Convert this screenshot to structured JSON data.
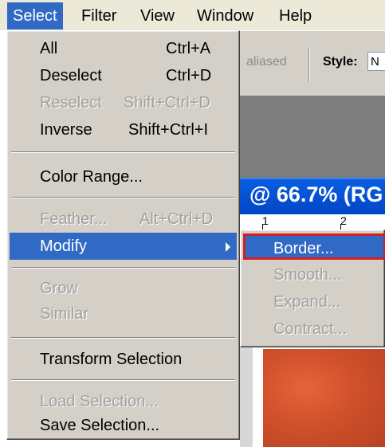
{
  "menubar": {
    "items": [
      {
        "label": "Select",
        "active": true
      },
      {
        "label": "Filter"
      },
      {
        "label": "View"
      },
      {
        "label": "Window"
      },
      {
        "label": "Help"
      }
    ]
  },
  "options_bar": {
    "aliased_label": "aliased",
    "style_label": "Style:",
    "style_value": "N"
  },
  "document": {
    "title": "@ 66.7% (RG",
    "ruler_labels": [
      "1",
      "2"
    ]
  },
  "select_menu": {
    "items": [
      {
        "label": "All",
        "shortcut": "Ctrl+A",
        "enabled": true
      },
      {
        "label": "Deselect",
        "shortcut": "Ctrl+D",
        "enabled": true
      },
      {
        "label": "Reselect",
        "shortcut": "Shift+Ctrl+D",
        "enabled": false
      },
      {
        "label": "Inverse",
        "shortcut": "Shift+Ctrl+I",
        "enabled": true
      },
      {
        "label": "Color Range...",
        "shortcut": "",
        "enabled": true
      },
      {
        "label": "Feather...",
        "shortcut": "Alt+Ctrl+D",
        "enabled": false
      },
      {
        "label": "Modify",
        "shortcut": "",
        "enabled": true,
        "highlighted": true,
        "submenu": true
      },
      {
        "label": "Grow",
        "shortcut": "",
        "enabled": false
      },
      {
        "label": "Similar",
        "shortcut": "",
        "enabled": false
      },
      {
        "label": "Transform Selection",
        "shortcut": "",
        "enabled": true
      },
      {
        "label": "Load Selection...",
        "shortcut": "",
        "enabled": false
      },
      {
        "label": "Save Selection...",
        "shortcut": "",
        "enabled": true
      }
    ]
  },
  "modify_menu": {
    "items": [
      {
        "label": "Border...",
        "enabled": true,
        "highlighted": true
      },
      {
        "label": "Smooth...",
        "enabled": false
      },
      {
        "label": "Expand...",
        "enabled": false
      },
      {
        "label": "Contract...",
        "enabled": false
      }
    ]
  },
  "colors": {
    "menu_bg": "#d4d0c8",
    "highlight": "#316ac5",
    "callout": "#d42020",
    "title_bar": "#0246c8"
  }
}
